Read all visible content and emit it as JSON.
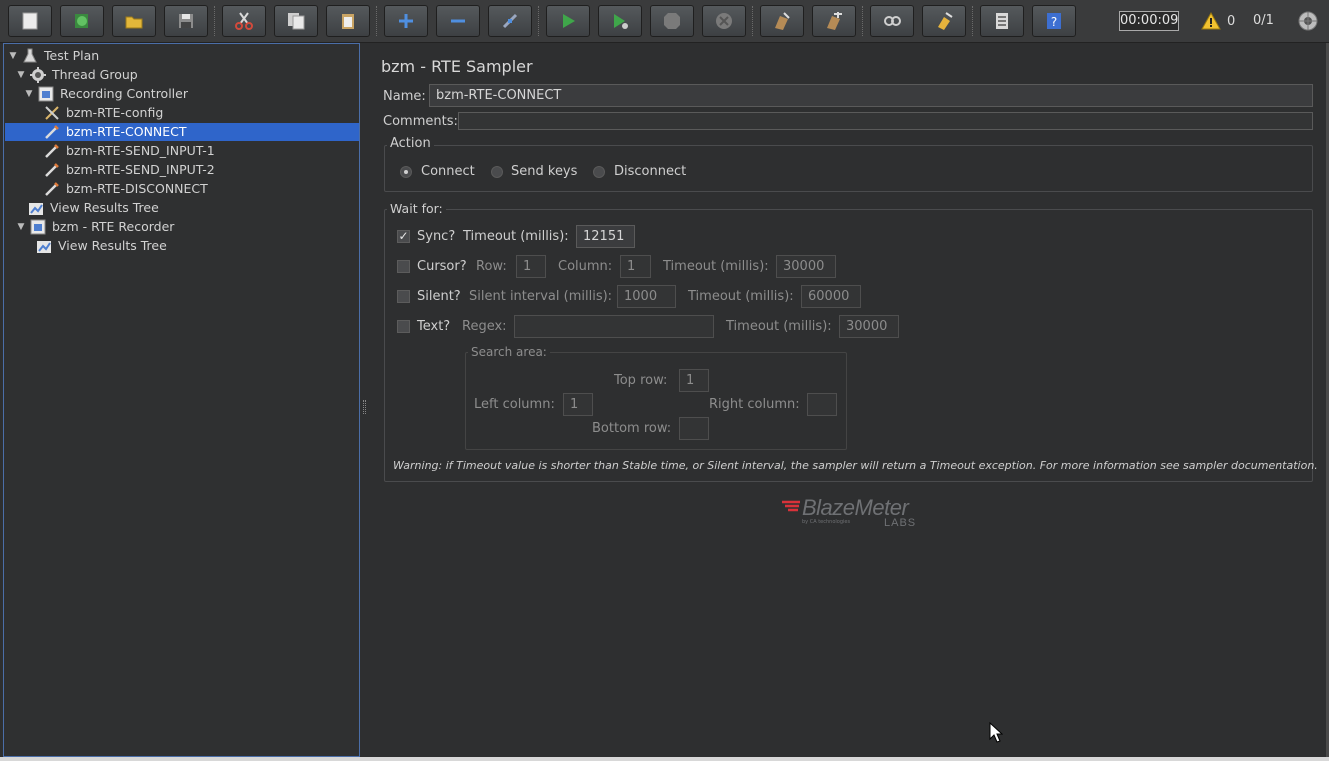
{
  "toolbar": {
    "buttons": [
      {
        "name": "new-icon",
        "color": "#e9e9e9"
      },
      {
        "name": "templates-icon",
        "color": "#5fae4d"
      },
      {
        "name": "open-icon",
        "color": "#e3b73a"
      },
      {
        "name": "save-icon",
        "color": "#9c9c9c"
      },
      {
        "name": "cut-icon",
        "color": "#d24a3c"
      },
      {
        "name": "copy-icon",
        "color": "#d9d9d9"
      },
      {
        "name": "paste-icon",
        "color": "#d4b879"
      },
      {
        "name": "expand-icon",
        "color": "#4f8fe0"
      },
      {
        "name": "collapse-icon",
        "color": "#4f8fe0"
      },
      {
        "name": "toggle-icon",
        "color": "#9aa7c0"
      },
      {
        "name": "start-icon",
        "color": "#3fa64a"
      },
      {
        "name": "start-no-pauses-icon",
        "color": "#3fa64a"
      },
      {
        "name": "stop-icon",
        "color": "#8a8a8a"
      },
      {
        "name": "shutdown-icon",
        "color": "#8a8a8a"
      },
      {
        "name": "clear-icon",
        "color": "#b58b56"
      },
      {
        "name": "clear-all-icon",
        "color": "#b58b56"
      },
      {
        "name": "search-icon",
        "color": "#cfcfcf"
      },
      {
        "name": "reset-search-icon",
        "color": "#e6b33c"
      },
      {
        "name": "function-helper-icon",
        "color": "#d9d9d9"
      },
      {
        "name": "help-icon",
        "color": "#3d6fd1"
      }
    ],
    "timer": "00:00:09",
    "warning_count": "0",
    "threads": "0/1"
  },
  "tree": {
    "nodes": [
      {
        "label": "Test Plan",
        "icon": "flask-icon",
        "expanded": true
      },
      {
        "label": "Thread Group",
        "icon": "gear-icon",
        "expanded": true
      },
      {
        "label": "Recording Controller",
        "icon": "controller-icon",
        "expanded": true
      },
      {
        "label": "bzm-RTE-config",
        "icon": "config-tools-icon"
      },
      {
        "label": "bzm-RTE-CONNECT",
        "icon": "sampler-pipette-icon",
        "selected": true
      },
      {
        "label": "bzm-RTE-SEND_INPUT-1",
        "icon": "sampler-pipette-icon"
      },
      {
        "label": "bzm-RTE-SEND_INPUT-2",
        "icon": "sampler-pipette-icon"
      },
      {
        "label": "bzm-RTE-DISCONNECT",
        "icon": "sampler-pipette-icon"
      },
      {
        "label": "View Results Tree",
        "icon": "chart-icon"
      },
      {
        "label": "bzm - RTE Recorder",
        "icon": "controller-icon",
        "expanded": true
      },
      {
        "label": "View Results Tree",
        "icon": "chart-icon"
      }
    ]
  },
  "panel": {
    "title": "bzm - RTE Sampler",
    "name_label": "Name:",
    "name_value": "bzm-RTE-CONNECT",
    "comments_label": "Comments:",
    "action": {
      "title": "Action",
      "options": [
        "Connect",
        "Send keys",
        "Disconnect"
      ],
      "selected": "Connect"
    },
    "wait_for": {
      "title": "Wait for:",
      "sync": {
        "label": "Sync?",
        "checked": true,
        "timeout_label": "Timeout (millis):",
        "timeout": "12151"
      },
      "cursor": {
        "label": "Cursor?",
        "checked": false,
        "row_label": "Row:",
        "row": "1",
        "column_label": "Column:",
        "column": "1",
        "timeout_label": "Timeout (millis):",
        "timeout": "30000"
      },
      "silent": {
        "label": "Silent?",
        "checked": false,
        "interval_label": "Silent interval (millis):",
        "interval": "1000",
        "timeout_label": "Timeout (millis):",
        "timeout": "60000"
      },
      "text": {
        "label": "Text?",
        "checked": false,
        "regex_label": "Regex:",
        "regex": "",
        "timeout_label": "Timeout (millis):",
        "timeout": "30000"
      },
      "search_area": {
        "title": "Search area:",
        "top_row_label": "Top row:",
        "top_row": "1",
        "left_column_label": "Left column:",
        "left_column": "1",
        "right_column_label": "Right column:",
        "right_column": "",
        "bottom_row_label": "Bottom row:",
        "bottom_row": ""
      }
    },
    "warning": "Warning: if Timeout value is shorter than Stable time, or Silent interval, the sampler will return a Timeout exception. For more information see sampler documentation."
  },
  "logo": {
    "brand": "BlazeMeter",
    "sub": "by CA technologies",
    "labs": "LABS",
    "accent": "#d8323a"
  },
  "colors": {
    "selection": "#2f65ca",
    "background": "#2e2f30"
  }
}
